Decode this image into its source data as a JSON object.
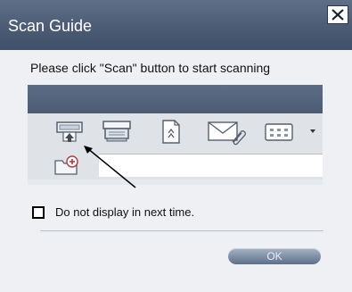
{
  "window": {
    "title": "Scan Guide",
    "close_icon": "close-icon"
  },
  "main": {
    "instruction": "Please click \"Scan\" button to start scanning"
  },
  "toolbar": {
    "buttons": [
      {
        "icon": "scan-icon"
      },
      {
        "icon": "scanner-icon"
      },
      {
        "icon": "document-icon"
      },
      {
        "icon": "email-icon"
      },
      {
        "icon": "grid-icon"
      }
    ],
    "more_icon": "chevron-down-icon"
  },
  "path_row": {
    "icon": "new-folder-icon",
    "value": ""
  },
  "options": {
    "do_not_display_label": "Do not display in next time.",
    "do_not_display_checked": false
  },
  "footer": {
    "ok_label": "OK"
  },
  "colors": {
    "title_bar": "#4a5a72",
    "panel_header": "#55667e",
    "ok_button": "#7d8ea6"
  }
}
